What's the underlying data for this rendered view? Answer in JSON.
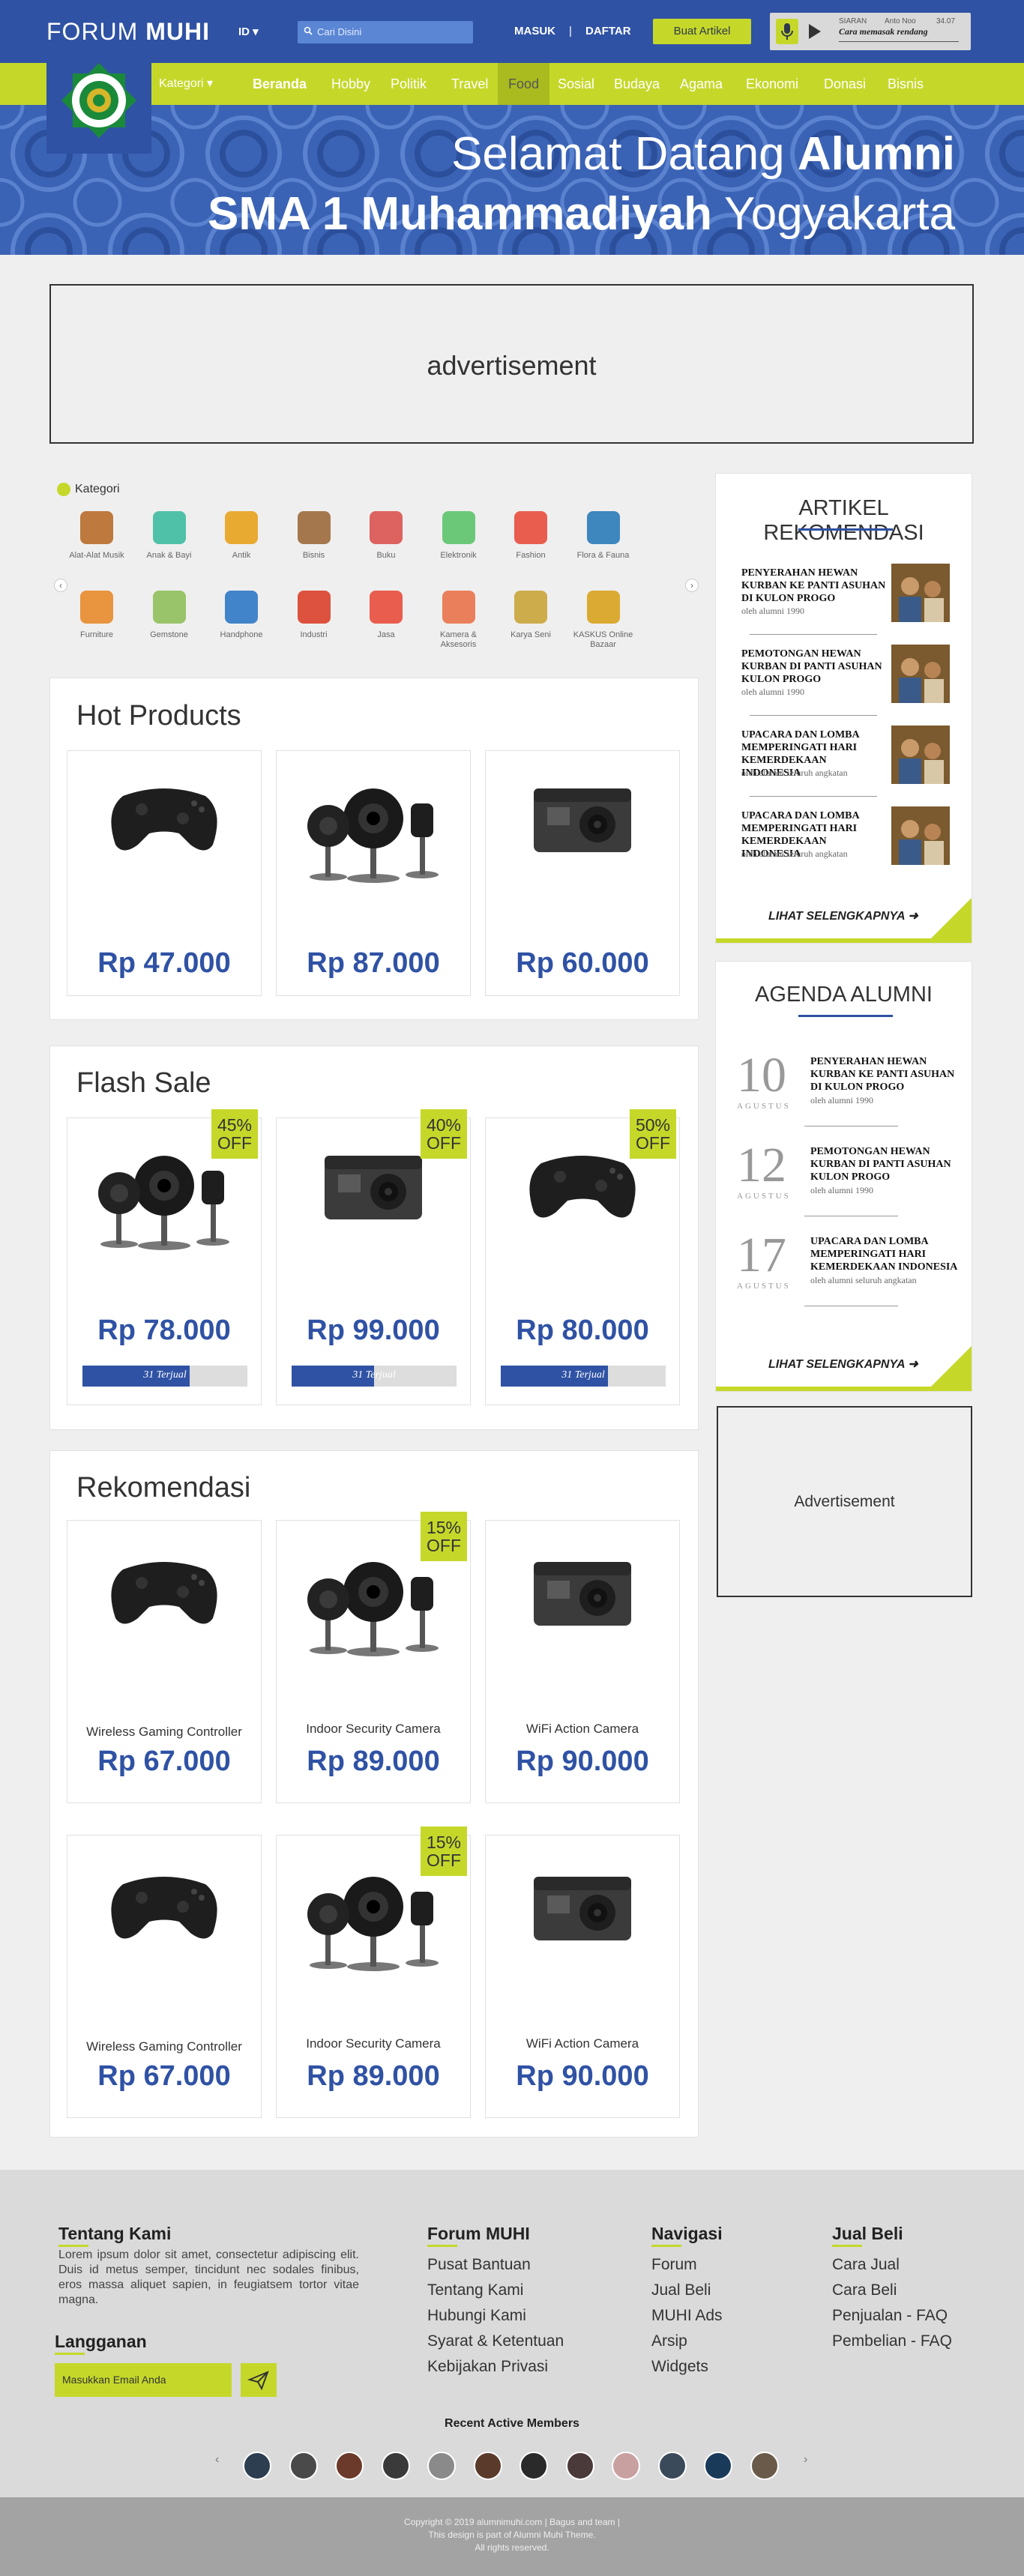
{
  "header": {
    "brand_light": "FORUM",
    "brand_bold": "MUHI",
    "lang": "ID ▾",
    "search_placeholder": "Cari Disini",
    "login": "MASUK",
    "separator": "|",
    "register": "DAFTAR",
    "write_button": "Buat Artikel",
    "radio": {
      "label": "SIARAN",
      "host": "Anto Noo",
      "time": "34.07",
      "title": "Cara memasak rendang"
    }
  },
  "nav": {
    "category": "Kategori ▾",
    "items": [
      "Beranda",
      "Hobby",
      "Politik",
      "Travel",
      "Food",
      "Sosial",
      "Budaya",
      "Agama",
      "Ekonomi",
      "Donasi",
      "Bisnis"
    ]
  },
  "banner": {
    "line1_light": "Selamat Datang ",
    "line1_bold": "Alumni",
    "line2_bold": "SMA 1 Muhammadiyah",
    "line2_light": " Yogyakarta"
  },
  "ad_top": "advertisement",
  "categories": {
    "title": "Kategori",
    "row1": [
      "Alat-Alat Musik",
      "Anak & Bayi",
      "Antik",
      "Bisnis",
      "Buku",
      "Elektronik",
      "Fashion",
      "Flora & Fauna"
    ],
    "row2": [
      "Furniture",
      "Gemstone",
      "Handphone",
      "Industri",
      "Jasa",
      "Kamera & Aksesoris",
      "Karya Seni",
      "KASKUS Online Bazaar"
    ]
  },
  "hot_products": {
    "title": "Hot Products",
    "prices": [
      "Rp 47.000",
      "Rp 87.000",
      "Rp 60.000"
    ]
  },
  "flash_sale": {
    "title": "Flash Sale",
    "items": [
      {
        "price": "Rp 78.000",
        "badge_pct": "45%",
        "badge_off": "OFF",
        "sold": "31 Terjual",
        "progress": 0.65
      },
      {
        "price": "Rp 99.000",
        "badge_pct": "40%",
        "badge_off": "OFF",
        "sold": "31 Terjual",
        "progress": 0.5
      },
      {
        "price": "Rp 80.000",
        "badge_pct": "50%",
        "badge_off": "OFF",
        "sold": "31 Terjual",
        "progress": 0.65
      }
    ]
  },
  "recommend": {
    "title": "Rekomendasi",
    "items": [
      {
        "name": "Wireless Gaming Controller",
        "price": "Rp 67.000"
      },
      {
        "name": "Indoor Security Camera",
        "price": "Rp 89.000",
        "badge_pct": "15%",
        "badge_off": "OFF"
      },
      {
        "name": "WiFi Action Camera",
        "price": "Rp 90.000"
      },
      {
        "name": "Wireless Gaming Controller",
        "price": "Rp 67.000"
      },
      {
        "name": "Indoor Security Camera",
        "price": "Rp 89.000",
        "badge_pct": "15%",
        "badge_off": "OFF"
      },
      {
        "name": "WiFi Action Camera",
        "price": "Rp 90.000"
      }
    ]
  },
  "articles": {
    "title": "ARTIKEL REKOMENDASI",
    "items": [
      {
        "title": "PENYERAHAN HEWAN KURBAN KE PANTI ASUHAN DI KULON PROGO",
        "by": "oleh alumni 1990"
      },
      {
        "title": "PEMOTONGAN HEWAN KURBAN DI PANTI ASUHAN KULON PROGO",
        "by": "oleh alumni 1990"
      },
      {
        "title": "UPACARA DAN LOMBA MEMPERINGATI HARI KEMERDEKAAN INDONESIA",
        "by": "oleh alumni seluruh angkatan"
      },
      {
        "title": "UPACARA DAN LOMBA MEMPERINGATI HARI KEMERDEKAAN INDONESIA",
        "by": "oleh alumni seluruh angkatan"
      }
    ],
    "more": "LIHAT SELENGKAPNYA"
  },
  "agenda": {
    "title": "AGENDA ALUMNI",
    "items": [
      {
        "day": "10",
        "month": "AGUSTUS",
        "title": "PENYERAHAN HEWAN KURBAN KE PANTI ASUHAN DI KULON PROGO",
        "by": "oleh alumni 1990"
      },
      {
        "day": "12",
        "month": "AGUSTUS",
        "title": "PEMOTONGAN HEWAN KURBAN DI PANTI ASUHAN KULON PROGO",
        "by": "oleh alumni 1990"
      },
      {
        "day": "17",
        "month": "AGUSTUS",
        "title": "UPACARA DAN LOMBA MEMPERINGATI HARI KEMERDEKAAN INDONESIA",
        "by": "oleh alumni seluruh angkatan"
      }
    ],
    "more": "LIHAT SELENGKAPNYA"
  },
  "ad_side": "Advertisement",
  "footer": {
    "about_title": "Tentang Kami",
    "about_text": "Lorem ipsum dolor sit amet, consectetur adipiscing elit. Duis id metus semper, tincidunt nec sodales finibus, eros massa aliquet sapien, in feugiatsem tortor vitae magna.",
    "subscribe_title": "Langganan",
    "email_placeholder": "Masukkan Email Anda",
    "forum_title": "Forum MUHI",
    "forum_links": [
      "Pusat Bantuan",
      "Tentang Kami",
      "Hubungi Kami",
      "Syarat & Ketentuan",
      "Kebijakan Privasi"
    ],
    "nav_title": "Navigasi",
    "nav_links": [
      "Forum",
      "Jual Beli",
      "MUHI Ads",
      "Arsip",
      "Widgets"
    ],
    "sell_title": "Jual Beli",
    "sell_links": [
      "Cara Jual",
      "Cara Beli",
      "Penjualan - FAQ",
      "Pembelian - FAQ"
    ],
    "members_title": "Recent Active Members",
    "copyright1": "Copyright © 2019 alumnimuhi.com | Bagus and team |",
    "copyright2": "This design is part of Alumni Muhi Theme.",
    "copyright3": "All rights reserved."
  }
}
